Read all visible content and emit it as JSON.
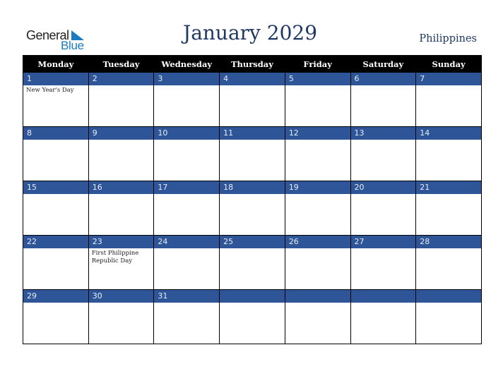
{
  "logo": {
    "word1": "General",
    "word2": "Blue",
    "accent_color": "#1a7bc0"
  },
  "header": {
    "title": "January 2029",
    "country": "Philippines",
    "title_color": "#1f3864"
  },
  "calendar": {
    "band_color": "#2e5597",
    "weekdays": [
      "Monday",
      "Tuesday",
      "Wednesday",
      "Thursday",
      "Friday",
      "Saturday",
      "Sunday"
    ],
    "weeks": [
      [
        {
          "day": "1",
          "holiday": "New Year's Day"
        },
        {
          "day": "2",
          "holiday": ""
        },
        {
          "day": "3",
          "holiday": ""
        },
        {
          "day": "4",
          "holiday": ""
        },
        {
          "day": "5",
          "holiday": ""
        },
        {
          "day": "6",
          "holiday": ""
        },
        {
          "day": "7",
          "holiday": ""
        }
      ],
      [
        {
          "day": "8",
          "holiday": ""
        },
        {
          "day": "9",
          "holiday": ""
        },
        {
          "day": "10",
          "holiday": ""
        },
        {
          "day": "11",
          "holiday": ""
        },
        {
          "day": "12",
          "holiday": ""
        },
        {
          "day": "13",
          "holiday": ""
        },
        {
          "day": "14",
          "holiday": ""
        }
      ],
      [
        {
          "day": "15",
          "holiday": ""
        },
        {
          "day": "16",
          "holiday": ""
        },
        {
          "day": "17",
          "holiday": ""
        },
        {
          "day": "18",
          "holiday": ""
        },
        {
          "day": "19",
          "holiday": ""
        },
        {
          "day": "20",
          "holiday": ""
        },
        {
          "day": "21",
          "holiday": ""
        }
      ],
      [
        {
          "day": "22",
          "holiday": ""
        },
        {
          "day": "23",
          "holiday": "First Philippine Republic Day"
        },
        {
          "day": "24",
          "holiday": ""
        },
        {
          "day": "25",
          "holiday": ""
        },
        {
          "day": "26",
          "holiday": ""
        },
        {
          "day": "27",
          "holiday": ""
        },
        {
          "day": "28",
          "holiday": ""
        }
      ],
      [
        {
          "day": "29",
          "holiday": ""
        },
        {
          "day": "30",
          "holiday": ""
        },
        {
          "day": "31",
          "holiday": ""
        },
        {
          "day": "",
          "holiday": ""
        },
        {
          "day": "",
          "holiday": ""
        },
        {
          "day": "",
          "holiday": ""
        },
        {
          "day": "",
          "holiday": ""
        }
      ]
    ]
  }
}
